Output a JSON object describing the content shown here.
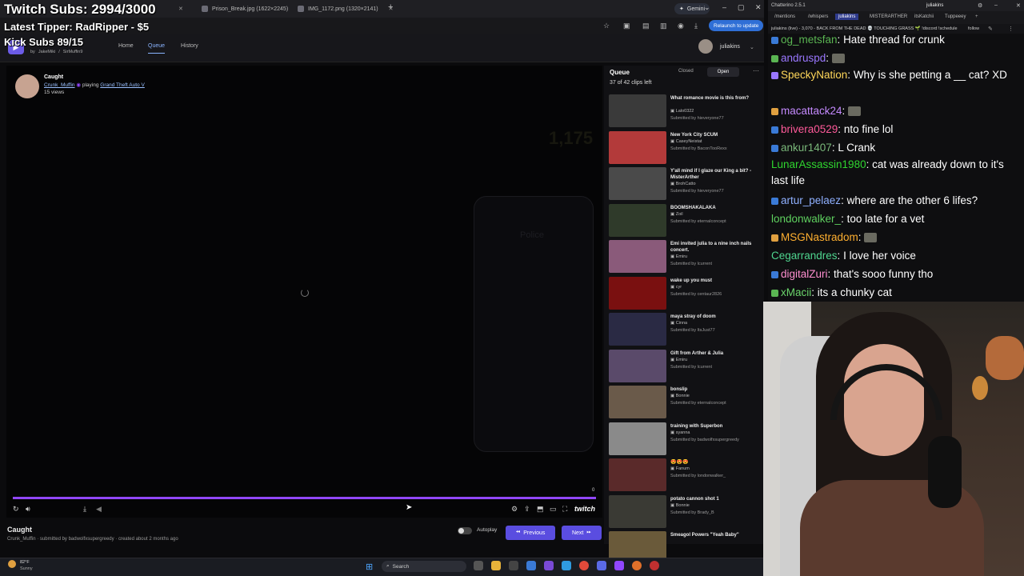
{
  "overlay": {
    "subs": "Twitch Subs: 2994/3000",
    "tipper": "Latest Tipper: RadRipper - $5",
    "kick": "Kick Subs 89/15"
  },
  "browser": {
    "tabs": [
      {
        "label": "",
        "active": true
      },
      {
        "label": "Prison_Break.jpg (1622×2245)"
      },
      {
        "label": "IMG_1172.png (1320×2141)"
      }
    ],
    "gemini": "Gemini",
    "relaunch": "Relaunch to update"
  },
  "site": {
    "by_label": "by",
    "creators": [
      "JakeMiki",
      "SirMuffin9"
    ],
    "nav": [
      "Home",
      "Queue",
      "History"
    ],
    "username": "juliakins"
  },
  "player": {
    "clip_title": "Caught",
    "streamer": "Crunk_Muffin",
    "playing_label": "playing",
    "game": "Grand Theft Auto V",
    "views": "15 views",
    "progress_num": "0",
    "progress_fraction": 1.0,
    "ghost_number": "1,175",
    "ghost_police": "Police"
  },
  "below": {
    "title": "Caught",
    "meta": "Crunk_Muffin · submitted by badwolfxsupergreedy · created about 2 months ago",
    "autoplay": "Autoplay",
    "previous": "Previous",
    "next": "Next"
  },
  "queue": {
    "title": "Queue",
    "count": "37 of 42 clips left",
    "closed": "Closed",
    "open": "Open",
    "items": [
      {
        "title": "What romance movie is this from?",
        "author": "Lalo0322",
        "sub": "Submitted by hieveryone77",
        "color": "#3a3a3a"
      },
      {
        "title": "New York City SCUM",
        "author": "CaseyNeistat",
        "sub": "Submitted by BaconTooRexx",
        "color": "#b33a3a"
      },
      {
        "title": "Y'all mind if I glaze our King a bit? - MisterArther",
        "author": "BrohCatto",
        "sub": "Submitted by hieveryone77",
        "color": "#4a4a4a"
      },
      {
        "title": "BOOMSHAKALAKA",
        "author": "Zoil",
        "sub": "Submitted by eternalconcept",
        "color": "#2f3a2a"
      },
      {
        "title": "Emi invited julia to a nine inch nails concert.",
        "author": "Emiru",
        "sub": "Submitted by lcurrent",
        "color": "#8a5a7a"
      },
      {
        "title": "wake up you must",
        "author": "cyr",
        "sub": "Submitted by centaur2826",
        "color": "#7a1010"
      },
      {
        "title": "maya stray of doom",
        "author": "Cinna",
        "sub": "Submitted by ItsJust77",
        "color": "#2a2a44"
      },
      {
        "title": "Gift from Arther & Julia",
        "author": "Emiru",
        "sub": "Submitted by lcurrent",
        "color": "#5a4a6a"
      },
      {
        "title": "bonslip",
        "author": "Bonnie",
        "sub": "Submitted by eternalconcept",
        "color": "#6a5a4a"
      },
      {
        "title": "training with Superbon",
        "author": "syanna",
        "sub": "Submitted by badwolfxsupergreedy",
        "color": "#8a8a8a"
      },
      {
        "title": "😍😍😍",
        "author": "Fanum",
        "sub": "Submitted by londonwalker_",
        "color": "#5a2a2a"
      },
      {
        "title": "potato cannon shot 1",
        "author": "Bonnie",
        "sub": "Submitted by Brady_B",
        "color": "#3a3a34"
      },
      {
        "title": "Smeagol Powers \"Yeah Baby\"",
        "author": "",
        "sub": "",
        "color": "#6a5a3a"
      }
    ]
  },
  "taskbar": {
    "temp": "82°F",
    "weather": "Sunny",
    "search": "Search"
  },
  "chatterino": {
    "title": "Chatterino 2.5.1",
    "user": "juliakins",
    "tabs": [
      "/mentions",
      "/whispers",
      "juliakins",
      "MISTERARTHER",
      "itsKatchii",
      "Tuppeeey"
    ],
    "status": "juliakins (live) - 3,070 - BACK FROM THE DEAD 💀 TOUCHING GRASS 🌱 !discord !schedule",
    "follow": "follow",
    "messages": [
      {
        "user": "og_metsfan",
        "text": "Hate thread for crunk",
        "color": "#5ab552"
      },
      {
        "user": "andruspd",
        "text": "",
        "color": "#9a77ff"
      },
      {
        "user": "SpeckyNation",
        "text": "Why is she petting a __ cat? XD",
        "color": "#ffd75a"
      },
      {
        "user": "macattack24",
        "text": "",
        "color": "#c58aff"
      },
      {
        "user": "brivera0529",
        "text": "nto fine lol",
        "color": "#ff5a9a"
      },
      {
        "user": "ankur1407",
        "text": "L Crank",
        "color": "#7ab87a"
      },
      {
        "user": "LunarAssassin1980",
        "text": "cat was already down to it's last life",
        "color": "#2fd52f"
      },
      {
        "user": "artur_pelaez",
        "text": "where are the other 6 lifes?",
        "color": "#8fb0ff"
      },
      {
        "user": "londonwalker_",
        "text": "too late for a vet",
        "color": "#5fd15f"
      },
      {
        "user": "MSGNastradom",
        "text": "",
        "color": "#ffb030"
      },
      {
        "user": "Cegarrandres",
        "text": "I love her voice",
        "color": "#4fd58f"
      },
      {
        "user": "digitalZuri",
        "text": "that's sooo funny tho",
        "color": "#ff8fd0"
      },
      {
        "user": "xMacii",
        "text": "its a chunky cat",
        "color": "#6bd56b"
      }
    ]
  }
}
